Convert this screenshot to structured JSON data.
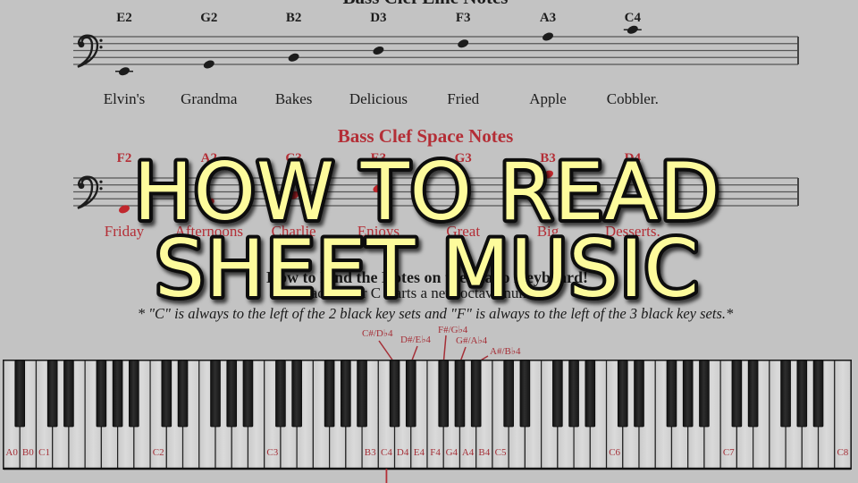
{
  "line_notes": {
    "heading": "Bass Clef Line Notes",
    "notes": [
      {
        "name": "E2",
        "word": "Elvin's",
        "step": -2,
        "ledger": true
      },
      {
        "name": "G2",
        "word": "Grandma",
        "step": 0,
        "ledger": false
      },
      {
        "name": "B2",
        "word": "Bakes",
        "step": 2,
        "ledger": false
      },
      {
        "name": "D3",
        "word": "Delicious",
        "step": 4,
        "ledger": false
      },
      {
        "name": "F3",
        "word": "Fried",
        "step": 6,
        "ledger": false
      },
      {
        "name": "A3",
        "word": "Apple",
        "step": 8,
        "ledger": false
      },
      {
        "name": "C4",
        "word": "Cobbler.",
        "step": 10,
        "ledger": true
      }
    ],
    "color": "#1c1c1c"
  },
  "space_notes": {
    "heading": "Bass Clef Space Notes",
    "notes": [
      {
        "name": "F2",
        "word": "Friday",
        "step": -1,
        "ledger": false
      },
      {
        "name": "A2",
        "word": "Afternoons",
        "step": 1,
        "ledger": false
      },
      {
        "name": "C3",
        "word": "Charlie",
        "step": 3,
        "ledger": false
      },
      {
        "name": "E3",
        "word": "Enjoys",
        "step": 5,
        "ledger": false
      },
      {
        "name": "G3",
        "word": "Great",
        "step": 7,
        "ledger": false
      },
      {
        "name": "B3",
        "word": "Big",
        "step": 9,
        "ledger": false
      },
      {
        "name": "D4",
        "word": "Desserts.",
        "step": 11,
        "ledger": false
      }
    ],
    "color": "#c0272d"
  },
  "instructions": {
    "title": "How to Find the Notes on the Piano Keyboard!",
    "subtitle": "Each letter C starts a new octave number.",
    "tip": "* \"C\" is always to the left of the 2 black key sets and \"F\" is always to the left of the 3 black key sets.*"
  },
  "keyboard": {
    "first_note": "A0",
    "white_key_count": 52,
    "labeled_keys": [
      "A0",
      "B0",
      "C1",
      "C2",
      "C3",
      "B3",
      "C4",
      "D4",
      "E4",
      "F4",
      "G4",
      "A4",
      "B4",
      "C5",
      "C6",
      "C7",
      "C8"
    ],
    "sharp_callouts": [
      {
        "label": "C#/D♭4",
        "key": "C#4"
      },
      {
        "label": "D#/E♭4",
        "key": "D#4"
      },
      {
        "label": "F#/G♭4",
        "key": "F#4"
      },
      {
        "label": "G#/A♭4",
        "key": "G#4"
      },
      {
        "label": "A#/B♭4",
        "key": "A#4"
      }
    ],
    "marked_key": "C4"
  },
  "title": {
    "line1": "HOW TO READ",
    "line2": "SHEET MUSIC",
    "fill_color": "#fdfb9c",
    "outline_color": "#0a0a0a"
  }
}
